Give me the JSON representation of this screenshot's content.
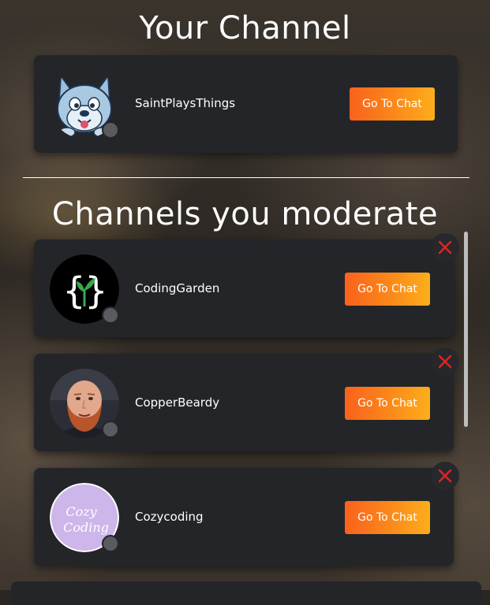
{
  "own_section": {
    "title": "Your Channel",
    "channel": {
      "name": "SaintPlaysThings",
      "avatar_icon": "wolf-cartoon-avatar-icon",
      "status": "offline",
      "button_label": "Go To Chat"
    }
  },
  "moderated_section": {
    "title": "Channels you moderate",
    "channels": [
      {
        "name": "CodingGarden",
        "avatar_icon": "curly-braces-sprout-logo-icon",
        "status": "offline",
        "button_label": "Go To Chat"
      },
      {
        "name": "CopperBeardy",
        "avatar_icon": "bearded-man-photo-avatar",
        "status": "offline",
        "button_label": "Go To Chat"
      },
      {
        "name": "Cozycoding",
        "avatar_icon": "cozy-coding-logo-icon",
        "avatar_text": "Cozy Coding",
        "status": "offline",
        "button_label": "Go To Chat"
      }
    ]
  },
  "colors": {
    "card_background": "#232529",
    "button_gradient_start": "#f9621c",
    "button_gradient_end": "#fcae1b",
    "remove_icon": "#e02424",
    "status_offline": "#5a5b5f"
  }
}
